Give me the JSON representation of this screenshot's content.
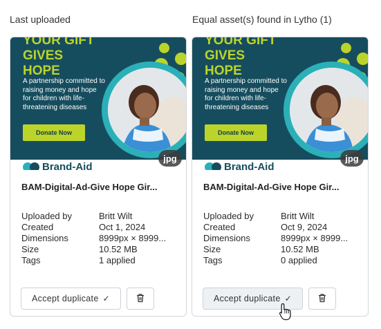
{
  "left_heading": "Last uploaded",
  "right_heading": "Equal asset(s) found in Lytho (1)",
  "thumbnail": {
    "headline_lines": [
      "YOUR GIFT",
      "GIVES",
      "HOPE"
    ],
    "body": "A partnership committed to raising money and hope for children with life-threatening diseases",
    "button": "Donate Now",
    "brand": "Brand-Aid",
    "file_type": "jpg"
  },
  "meta_labels": {
    "uploaded_by": "Uploaded by",
    "created": "Created",
    "dimensions": "Dimensions",
    "size": "Size",
    "tags": "Tags"
  },
  "cards": [
    {
      "name": "BAM-Digital-Ad-Give Hope Gir...",
      "uploaded_by": "Britt Wilt",
      "created": "Oct 1, 2024",
      "dimensions": "8999px × 8999...",
      "size": "10.52 MB",
      "tags": "1 applied",
      "accept_label": "Accept duplicate"
    },
    {
      "name": "BAM-Digital-Ad-Give Hope Gir...",
      "uploaded_by": "Britt Wilt",
      "created": "Oct 9, 2024",
      "dimensions": "8999px × 8999...",
      "size": "10.52 MB",
      "tags": "0 applied",
      "accept_label": "Accept duplicate"
    }
  ],
  "colors": {
    "thumb_bg": "#164d5e",
    "accent_lime": "#bcd42a",
    "accent_teal": "#2bb0b8",
    "card_border": "#d4d7db"
  },
  "icons": [
    "check-icon",
    "trash-icon",
    "hand-pointer-cursor-icon"
  ]
}
